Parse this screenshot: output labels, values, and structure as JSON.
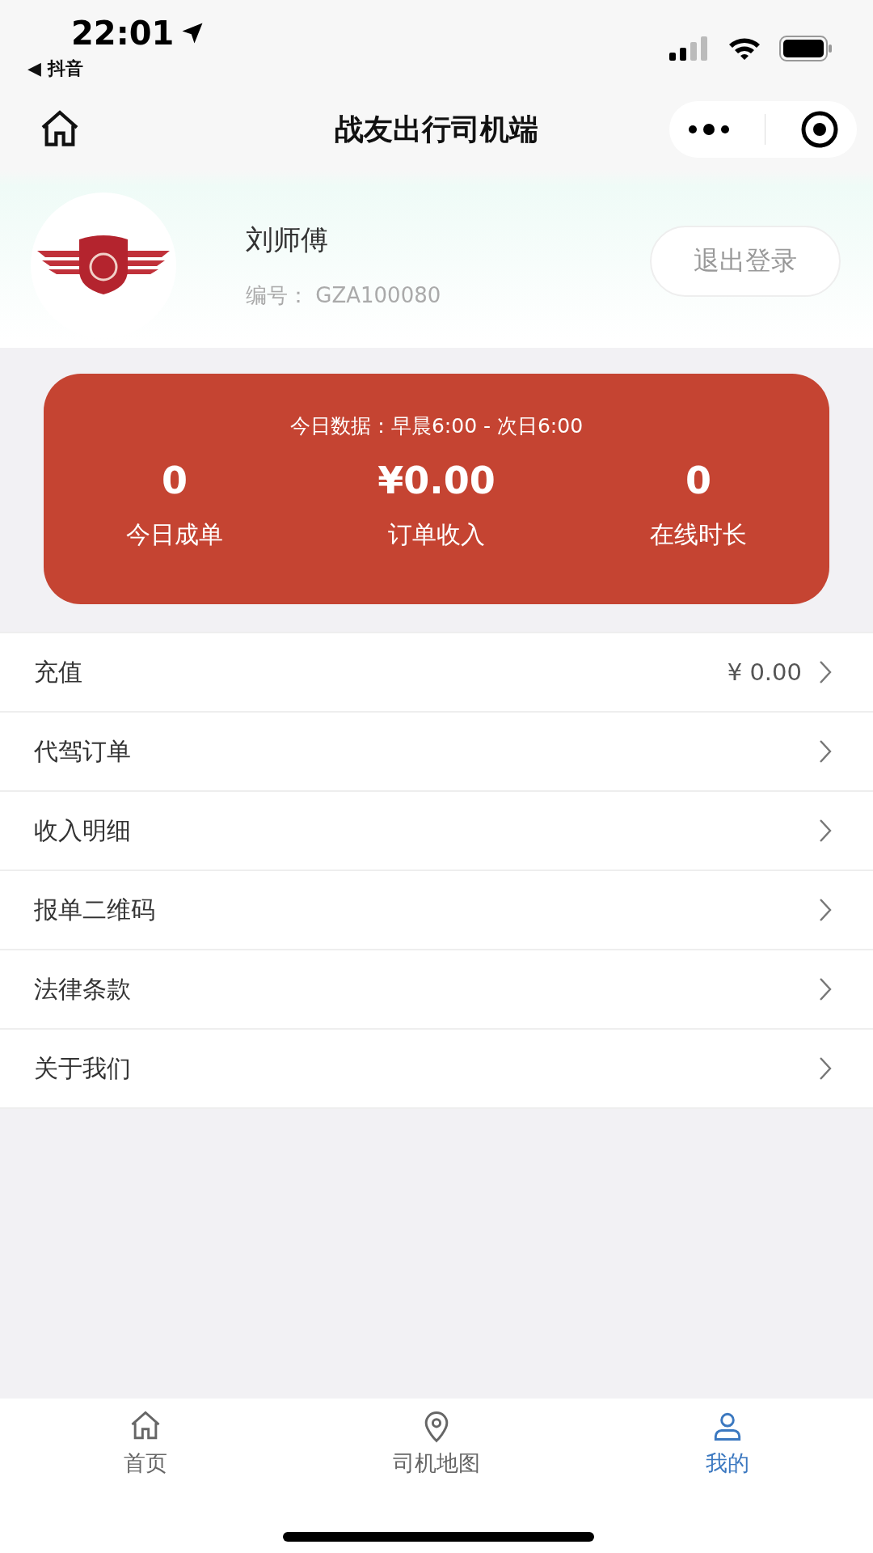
{
  "status_bar": {
    "time": "22:01",
    "back_app": "◀ 抖音"
  },
  "nav": {
    "title": "战友出行司机端"
  },
  "profile": {
    "name": "刘师傅",
    "id_label": "编号：",
    "id_value": "GZA100080",
    "logout": "退出登录"
  },
  "stats_card": {
    "caption": "今日数据：早晨6:00 - 次日6:00",
    "stats": [
      {
        "value": "0",
        "label": "今日成单"
      },
      {
        "value": "¥0.00",
        "label": "订单收入"
      },
      {
        "value": "0",
        "label": "在线时长"
      }
    ]
  },
  "menu": [
    {
      "label": "充值",
      "value": "¥ 0.00"
    },
    {
      "label": "代驾订单"
    },
    {
      "label": "收入明细"
    },
    {
      "label": "报单二维码"
    },
    {
      "label": "法律条款"
    },
    {
      "label": "关于我们"
    }
  ],
  "tab_bar": [
    {
      "label": "首页",
      "kind": "home",
      "selected": false
    },
    {
      "label": "司机地图",
      "kind": "map",
      "selected": false
    },
    {
      "label": "我的",
      "kind": "profile",
      "selected": true
    }
  ]
}
